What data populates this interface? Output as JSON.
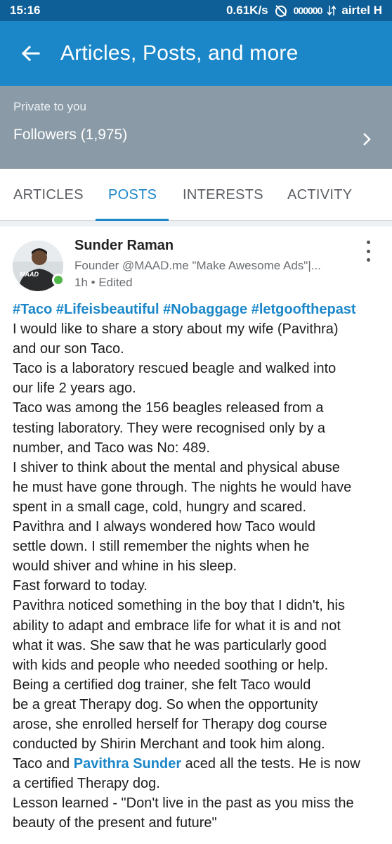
{
  "status_bar": {
    "time": "15:16",
    "speed": "0.61K/s",
    "signal_dots": "000000",
    "carrier": "airtel H"
  },
  "app_bar": {
    "title": "Articles, Posts, and more",
    "back_icon": "arrow-left-icon"
  },
  "privacy": {
    "label": "Private to you",
    "followers": "Followers (1,975)"
  },
  "tabs": [
    {
      "label": "ARTICLES",
      "active": false
    },
    {
      "label": "POSTS",
      "active": true
    },
    {
      "label": "INTERESTS",
      "active": false
    },
    {
      "label": "ACTIVITY",
      "active": false
    }
  ],
  "post": {
    "author": "Sunder Raman",
    "headline": "Founder @MAAD.me \"Make Awesome Ads\"|...",
    "time": "1h",
    "edited": "• Edited",
    "avatar_text": "MAAD",
    "hashtags": "#Taco #Lifeisbeautiful #Nobaggage #letgoofthepast",
    "lines": [
      "I would like to share a story about my wife (Pavithra)",
      "and our son Taco.",
      "Taco is a laboratory rescued beagle and walked into",
      "our life 2 years ago.",
      "Taco was among the 156 beagles released from a",
      "testing  laboratory. They were recognised only by a",
      "number, and Taco was No: 489.",
      "I shiver to think about the mental and physical abuse",
      "he must have gone through. The nights he would have",
      "spent in a small cage, cold, hungry and scared.",
      "Pavithra and I always wondered how Taco would",
      "settle down. I still remember the nights when he",
      "would shiver and whine in his sleep.",
      "Fast forward to today.",
      "Pavithra noticed something in the boy that I didn't, his",
      "ability to adapt and embrace life for what it is and not",
      "what it was. She saw that he was particularly good",
      "with kids and people who needed soothing or help.",
      "Being a certified dog trainer, she felt Taco would",
      "be a great Therapy dog. So when the opportunity",
      "arose, she enrolled herself for   Therapy dog course",
      "conducted by Shirin Merchant and took him along."
    ],
    "mention_line": {
      "before": "Taco and ",
      "mention": "Pavithra Sunder",
      "after": " aced all the tests. He is now"
    },
    "lines_after": [
      "a certified Therapy dog.",
      "Lesson learned - \"Don't live in the past as you miss the",
      "beauty of the present and future\""
    ]
  }
}
